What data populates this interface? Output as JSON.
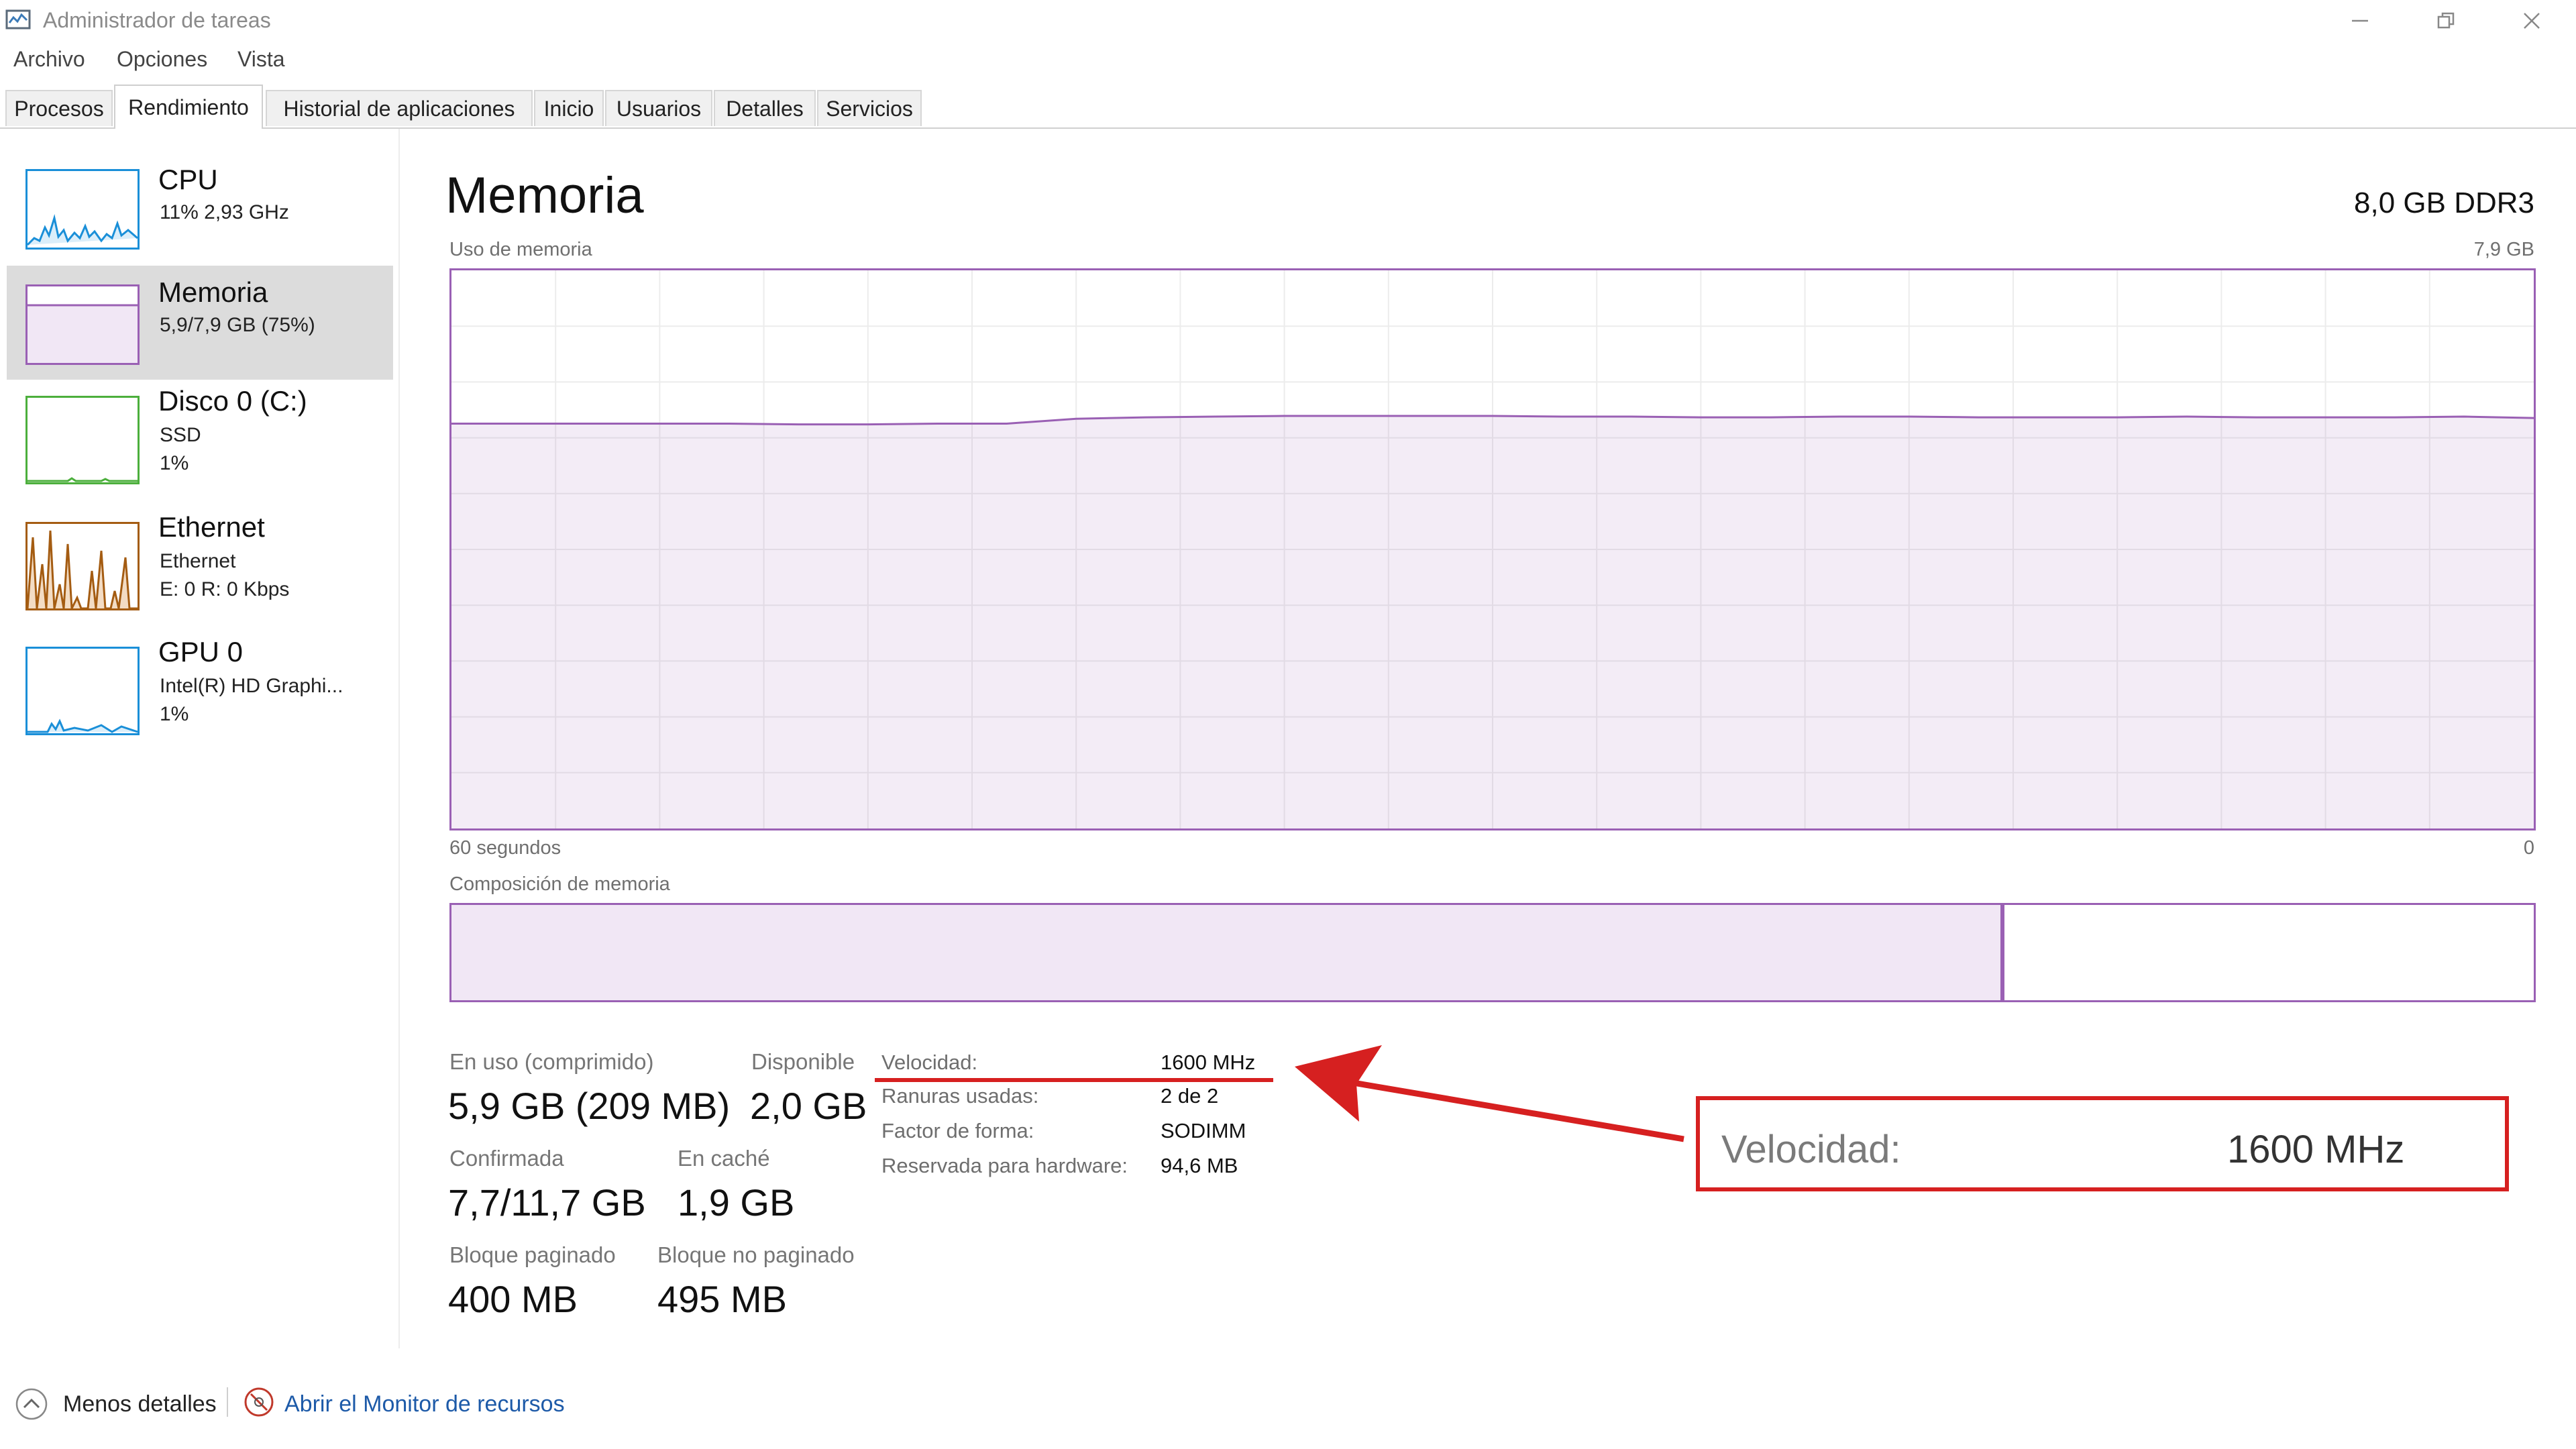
{
  "window": {
    "title": "Administrador de tareas",
    "controls": [
      "minimize",
      "restore",
      "close"
    ]
  },
  "menu": [
    "Archivo",
    "Opciones",
    "Vista"
  ],
  "tabs": [
    {
      "label": "Procesos",
      "active": false
    },
    {
      "label": "Rendimiento",
      "active": true
    },
    {
      "label": "Historial de aplicaciones",
      "active": false
    },
    {
      "label": "Inicio",
      "active": false
    },
    {
      "label": "Usuarios",
      "active": false
    },
    {
      "label": "Detalles",
      "active": false
    },
    {
      "label": "Servicios",
      "active": false
    }
  ],
  "sidebar": {
    "items": [
      {
        "title": "CPU",
        "sub1": "11% 2,93 GHz",
        "sub2": "",
        "selected": false,
        "color": "#1a8fd8",
        "icon": "cpu-graph"
      },
      {
        "title": "Memoria",
        "sub1": "5,9/7,9 GB (75%)",
        "sub2": "",
        "selected": true,
        "color": "#9a60b4",
        "icon": "memory-graph"
      },
      {
        "title": "Disco 0 (C:)",
        "sub1": "SSD",
        "sub2": "1%",
        "selected": false,
        "color": "#4caf3c",
        "icon": "disk-graph"
      },
      {
        "title": "Ethernet",
        "sub1": "Ethernet",
        "sub2": "E: 0 R: 0 Kbps",
        "selected": false,
        "color": "#a45c12",
        "icon": "ethernet-graph"
      },
      {
        "title": "GPU 0",
        "sub1": "Intel(R) HD Graphi...",
        "sub2": "1%",
        "selected": false,
        "color": "#1a8fd8",
        "icon": "gpu-graph"
      }
    ]
  },
  "main": {
    "title": "Memoria",
    "spec": "8,0 GB DDR3",
    "usage_label": "Uso de memoria",
    "usage_max": "7,9 GB",
    "time_label": "60 segundos",
    "time_end": "0",
    "composition_label": "Composición de memoria",
    "accent": "#9a60b4"
  },
  "chart_data": {
    "type": "area",
    "title": "Uso de memoria",
    "xlabel": "",
    "ylabel": "",
    "x_range": [
      60,
      0
    ],
    "ylim": [
      0,
      7.9
    ],
    "grid": true,
    "series": [
      {
        "values": [
          5.73,
          5.73,
          5.73,
          5.73,
          5.73,
          5.72,
          5.72,
          5.73,
          5.73,
          5.8,
          5.82,
          5.83,
          5.84,
          5.84,
          5.84,
          5.84,
          5.83,
          5.83,
          5.82,
          5.82,
          5.83,
          5.83,
          5.82,
          5.82,
          5.82,
          5.83,
          5.82,
          5.82,
          5.82,
          5.83,
          5.81
        ]
      }
    ],
    "composition": {
      "in_use_fraction": 0.745,
      "free_fraction": 0.24
    }
  },
  "stats": {
    "in_use_label": "En uso (comprimido)",
    "in_use_value": "5,9 GB (209 MB)",
    "available_label": "Disponible",
    "available_value": "2,0 GB",
    "committed_label": "Confirmada",
    "committed_value": "7,7/11,7 GB",
    "cached_label": "En caché",
    "cached_value": "1,9 GB",
    "paged_label": "Bloque paginado",
    "paged_value": "400 MB",
    "nonpaged_label": "Bloque no paginado",
    "nonpaged_value": "495 MB"
  },
  "specs": [
    {
      "label": "Velocidad:",
      "value": "1600 MHz"
    },
    {
      "label": "Ranuras usadas:",
      "value": "2 de 2"
    },
    {
      "label": "Factor de forma:",
      "value": "SODIMM"
    },
    {
      "label": "Reservada para hardware:",
      "value": "94,6 MB"
    }
  ],
  "annotation": {
    "label": "Velocidad:",
    "value": "1600 MHz",
    "color": "#d62020"
  },
  "footer": {
    "less_details": "Menos detalles",
    "resource_monitor": "Abrir el Monitor de recursos"
  }
}
